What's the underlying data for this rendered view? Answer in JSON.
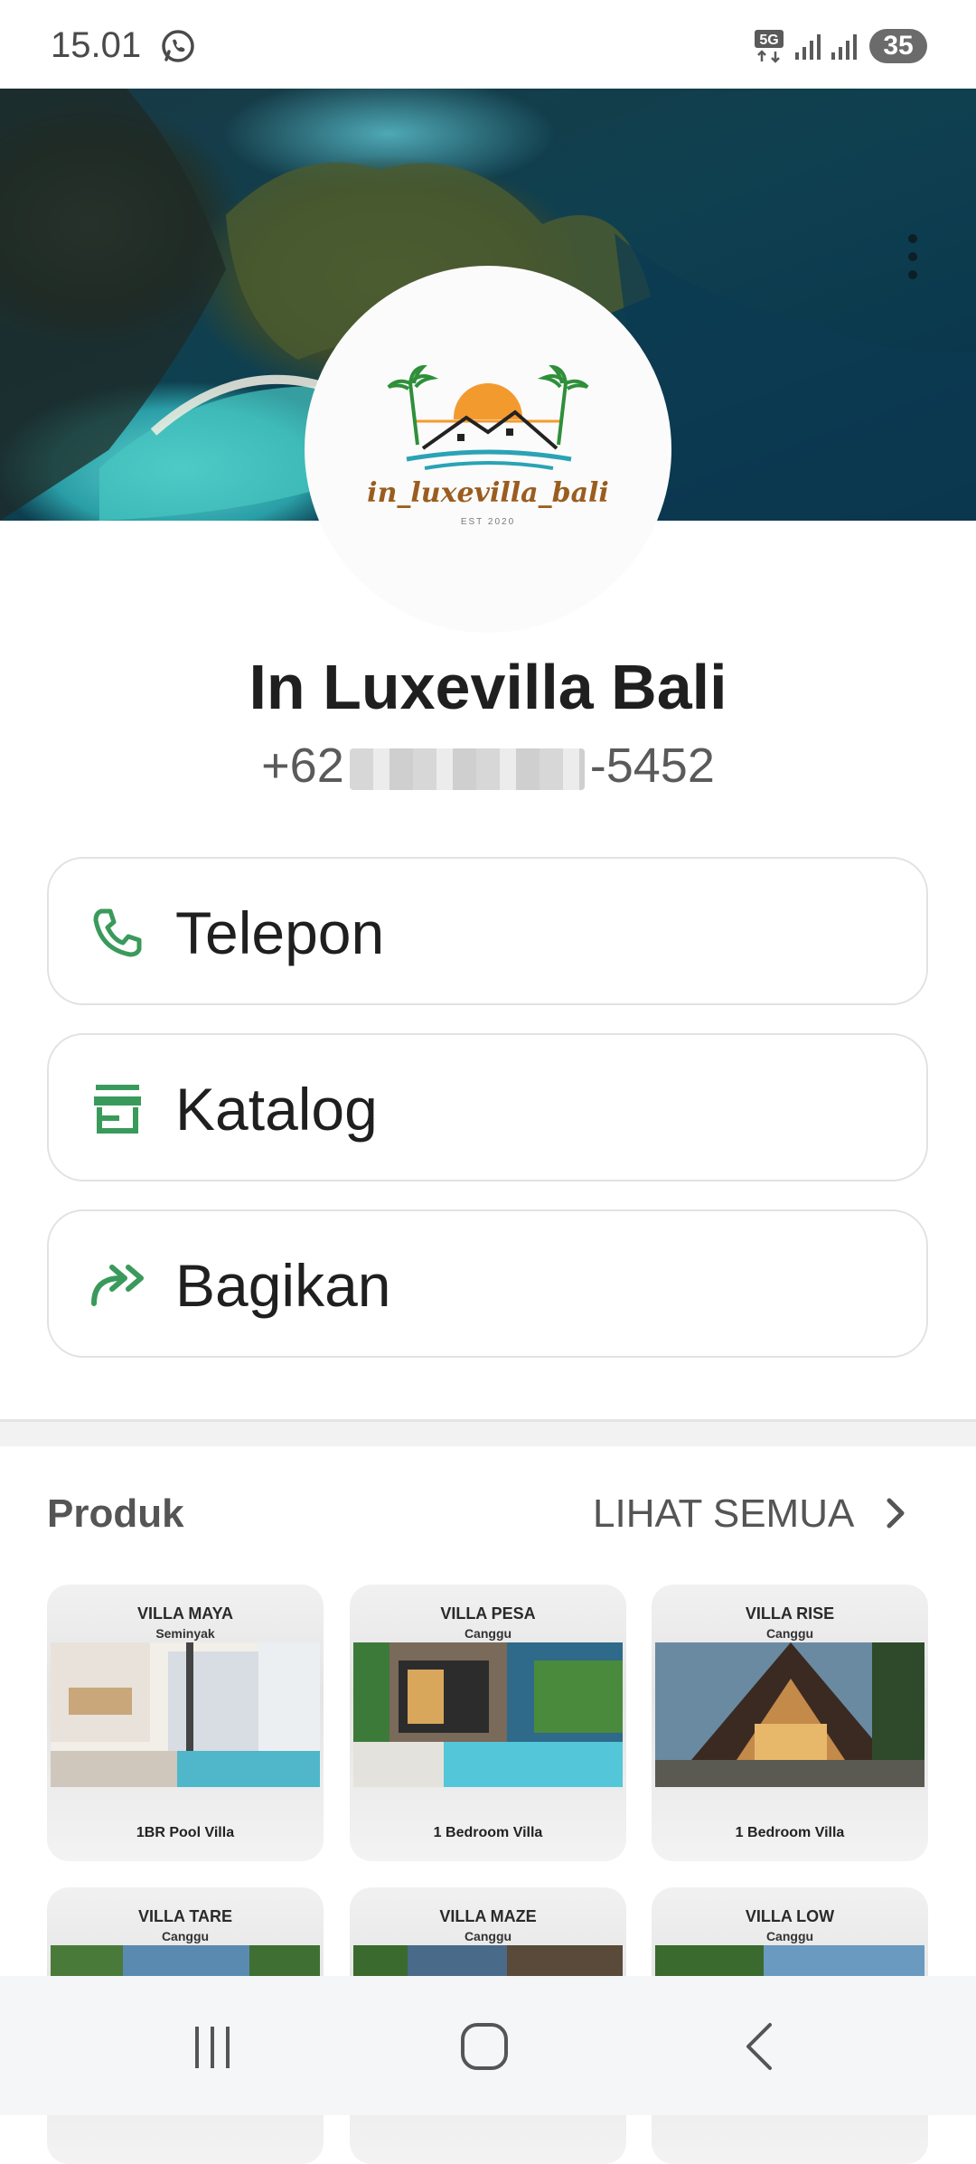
{
  "status_bar": {
    "time": "15.01",
    "network": "5G",
    "battery": "35"
  },
  "profile": {
    "logo_text": "in_luxevilla_bali",
    "logo_subtext": "EST 2020",
    "name": "In Luxevilla Bali",
    "phone_prefix": "+62",
    "phone_suffix": "-5452"
  },
  "actions": [
    {
      "label": "Telepon",
      "icon": "phone-icon"
    },
    {
      "label": "Katalog",
      "icon": "store-icon"
    },
    {
      "label": "Bagikan",
      "icon": "share-icon"
    }
  ],
  "products": {
    "title": "Produk",
    "see_all": "LIHAT SEMUA",
    "items": [
      {
        "name": "VILLA MAYA",
        "location": "Seminyak",
        "type": "1BR Pool Villa"
      },
      {
        "name": "VILLA PESA",
        "location": "Canggu",
        "type": "1 Bedroom Villa"
      },
      {
        "name": "VILLA RISE",
        "location": "Canggu",
        "type": "1 Bedroom Villa"
      },
      {
        "name": "VILLA TARE",
        "location": "Canggu",
        "type": ""
      },
      {
        "name": "VILLA MAZE",
        "location": "Canggu",
        "type": ""
      },
      {
        "name": "VILLA LOW",
        "location": "Canggu",
        "type": ""
      }
    ]
  },
  "colors": {
    "accent_green": "#3a9a5b",
    "text_dark": "#1f1f1f",
    "text_muted": "#5a5a5a"
  },
  "nav": {
    "recent": "recents-icon",
    "home": "home-icon",
    "back": "back-icon"
  }
}
